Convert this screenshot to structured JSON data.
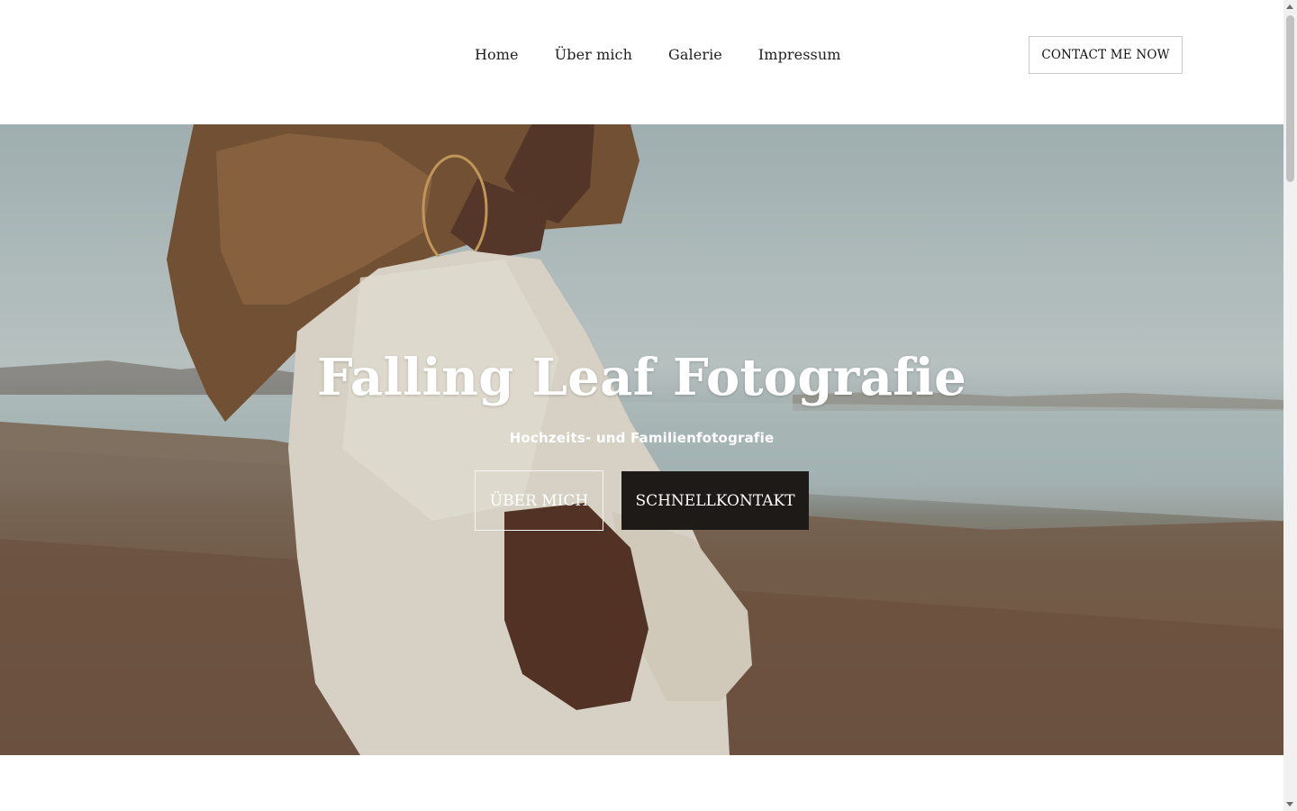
{
  "header": {
    "nav": [
      {
        "label": "Home"
      },
      {
        "label": "Über mich"
      },
      {
        "label": "Galerie"
      },
      {
        "label": "Impressum"
      }
    ],
    "contact_label": "CONTACT ME NOW"
  },
  "hero": {
    "title": "Falling Leaf Fotografie",
    "subtitle": "Hochzeits- und Familienfotografie",
    "button_about": "ÜBER MICH",
    "button_contact": "SCHNELLKONTAKT",
    "image": "woman-in-knit-sweater-on-beach-photo"
  },
  "colors": {
    "background": "#ffffff",
    "button_dark": "#1e1a17",
    "hero_text": "#ffffff"
  }
}
